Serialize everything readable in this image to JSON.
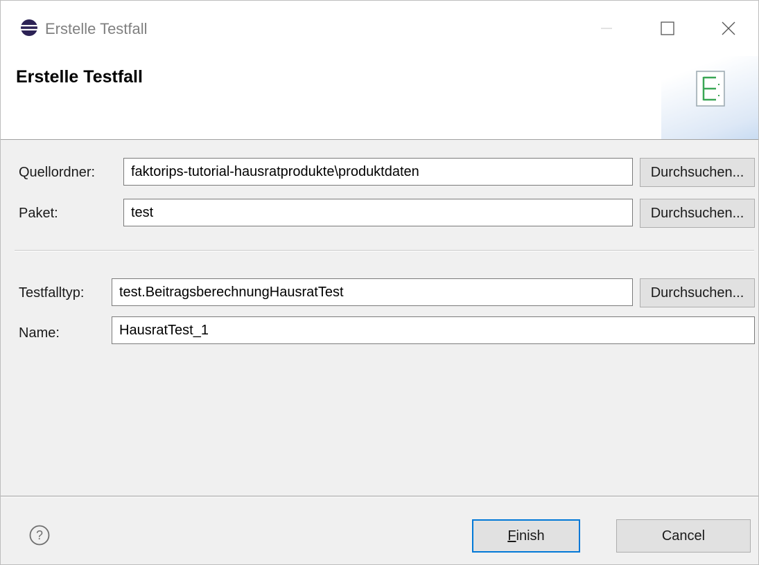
{
  "window": {
    "title": "Erstelle Testfall",
    "controls": {
      "minimize": "minimize-icon",
      "maximize": "maximize-icon",
      "close": "close-icon"
    }
  },
  "header": {
    "title": "Erstelle Testfall",
    "icon": "wizard-testcase-icon"
  },
  "form": {
    "source_folder": {
      "label": "Quellordner:",
      "value": "faktorips-tutorial-hausratprodukte\\produktdaten",
      "browse": "Durchsuchen..."
    },
    "package": {
      "label": "Paket:",
      "value": "test",
      "browse": "Durchsuchen..."
    },
    "testcase_type": {
      "label": "Testfalltyp:",
      "value": "test.BeitragsberechnungHausratTest",
      "browse": "Durchsuchen..."
    },
    "name": {
      "label": "Name:",
      "value": "HausratTest_1"
    }
  },
  "footer": {
    "help_icon": "help-icon",
    "finish_mnemonic": "F",
    "finish_rest": "inish",
    "cancel": "Cancel"
  },
  "colors": {
    "accent": "#0078d7",
    "icon_green": "#3aa655"
  }
}
